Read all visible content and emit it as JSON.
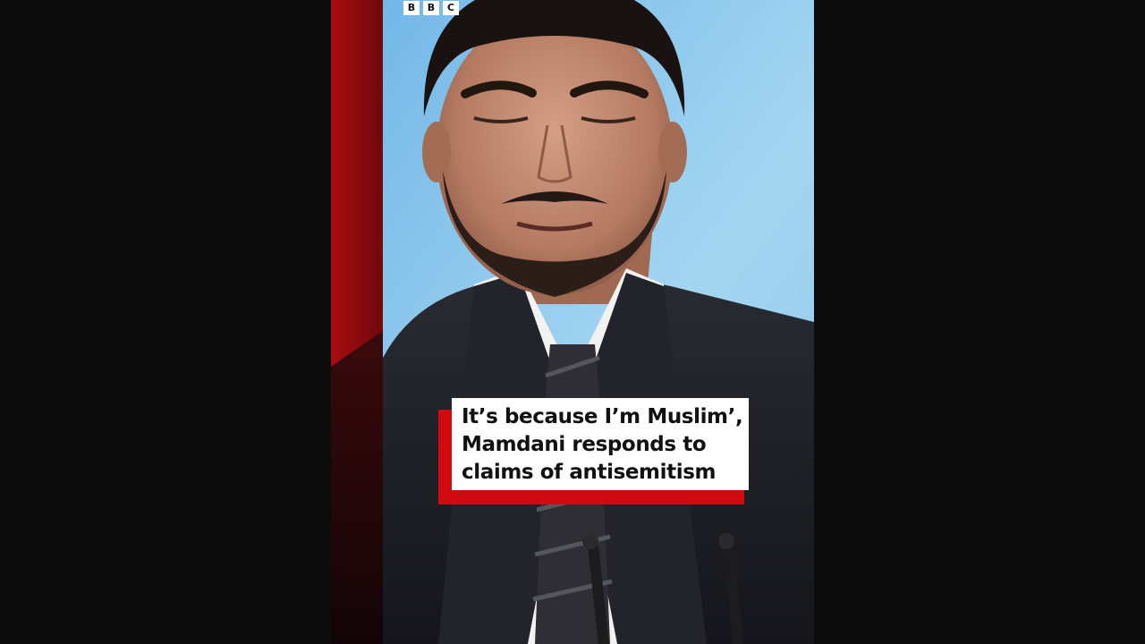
{
  "brand": {
    "letters": [
      "B",
      "B",
      "C"
    ]
  },
  "caption": {
    "lines": [
      "It’s because I’m Muslim’,",
      "Mamdani responds to",
      "claims of antisemitism"
    ]
  },
  "colors": {
    "page_background": "#0c0c0c",
    "brand_red": "#d10a11",
    "caption_background": "#ffffff",
    "caption_text": "#111111",
    "backdrop_blue": "#8fc9ea"
  }
}
